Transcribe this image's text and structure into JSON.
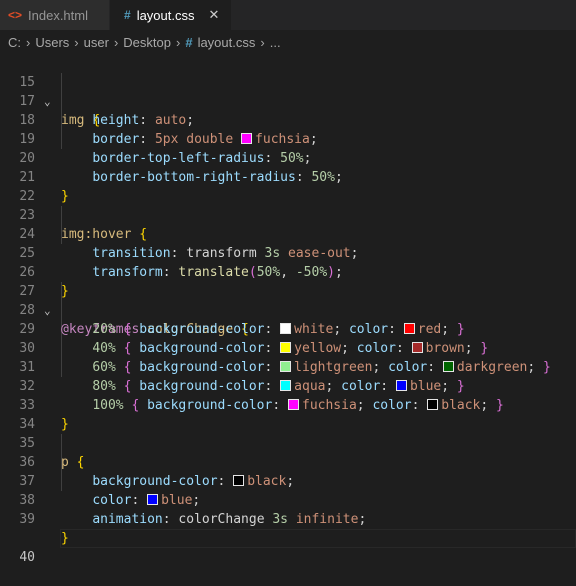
{
  "tabs": [
    {
      "label": "Index.html",
      "icon": "html-file-icon"
    },
    {
      "label": "layout.css",
      "icon": "css-file-icon",
      "close": "✕"
    }
  ],
  "breadcrumbs": {
    "items": [
      "C:",
      "Users",
      "user",
      "Desktop",
      "layout.css",
      "..."
    ]
  },
  "lines": {
    "n15": "15",
    "n17": "17",
    "n18": "18",
    "n19": "19",
    "n20": "20",
    "n21": "21",
    "n22": "22",
    "n23": "23",
    "n24": "24",
    "n25": "25",
    "n26": "26",
    "n27": "27",
    "n28": "28",
    "n29": "29",
    "n30": "30",
    "n31": "31",
    "n32": "32",
    "n33": "33",
    "n34": "34",
    "n35": "35",
    "n36": "36",
    "n37": "37",
    "n38": "38",
    "n39": "39",
    "n40": "40"
  },
  "code": {
    "img_sel": "img",
    "height_prop": "height",
    "height_val": "auto",
    "border_prop": "border",
    "border_val1": "5px double",
    "border_val2": "fuchsia",
    "btl_prop": "border-top-left-radius",
    "btl_val": "50%",
    "bbr_prop": "border-bottom-right-radius",
    "bbr_val": "50%",
    "imghover_sel": "img:hover",
    "transition_prop": "transition",
    "transition_val1": "transform",
    "transition_val2": "3s",
    "transition_val3": "ease-out",
    "transform_prop": "transform",
    "transform_fn": "translate",
    "transform_arg1": "50%",
    "transform_arg2": "-50%",
    "keyframes_kw": "@keyframes",
    "keyframes_name": "colorChange",
    "kf": [
      {
        "pct": "20%",
        "bg": "white",
        "bg_color": "#ffffff",
        "fg": "red",
        "fg_color": "#ff0000"
      },
      {
        "pct": "40%",
        "bg": "yellow",
        "bg_color": "#ffff00",
        "fg": "brown",
        "fg_color": "#a52a2a"
      },
      {
        "pct": "60%",
        "bg": "lightgreen",
        "bg_color": "#90ee90",
        "fg": "darkgreen",
        "fg_color": "#006400"
      },
      {
        "pct": "80%",
        "bg": "aqua",
        "bg_color": "#00ffff",
        "fg": "blue",
        "fg_color": "#0000ff"
      },
      {
        "pct": "100%",
        "bg": "fuchsia",
        "bg_color": "#ff00ff",
        "fg": "black",
        "fg_color": "#000000"
      }
    ],
    "bgcolor_prop": "background-color",
    "color_prop": "color",
    "p_sel": "p",
    "p_bg_val": "black",
    "p_color_val": "blue",
    "animation_prop": "animation",
    "animation_val1": "colorChange",
    "animation_val2": "3s",
    "animation_val3": "infinite"
  },
  "colors": {
    "fuchsia": "#ff00ff",
    "black": "#000000",
    "blue": "#0000ff"
  }
}
